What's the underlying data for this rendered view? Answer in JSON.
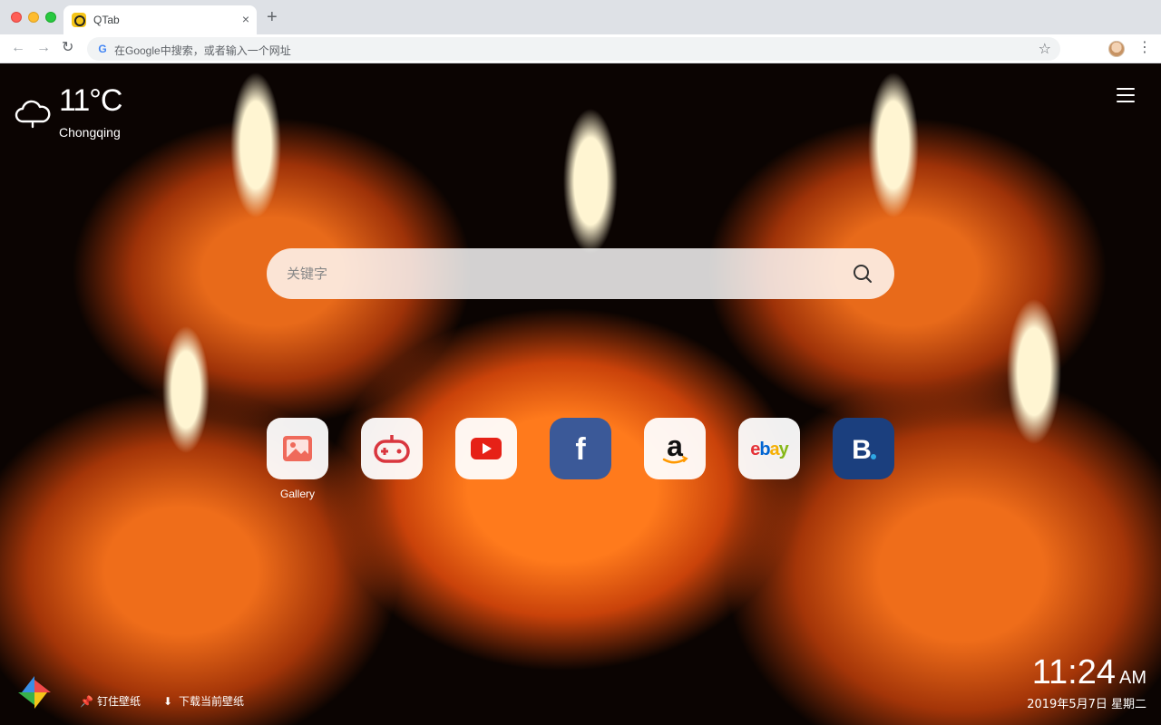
{
  "browser": {
    "tab_title": "QTab",
    "tab_close": "×",
    "new_tab": "+",
    "back": "←",
    "forward": "→",
    "reload": "↻",
    "omnibox_placeholder": "在Google中搜索，或者输入一个网址",
    "omnibox_icon": "G",
    "star": "☆",
    "menu": "⋮"
  },
  "weather": {
    "temperature": "11°C",
    "city": "Chongqing",
    "icon": "cloud-rain-icon"
  },
  "search": {
    "placeholder": "关键字"
  },
  "shortcuts": [
    {
      "name": "gallery",
      "label": "Gallery",
      "icon": "gallery-icon"
    },
    {
      "name": "games",
      "label": "",
      "icon": "gamepad-icon"
    },
    {
      "name": "youtube",
      "label": "",
      "icon": "youtube-icon"
    },
    {
      "name": "facebook",
      "label": "",
      "icon": "facebook-icon"
    },
    {
      "name": "amazon",
      "label": "",
      "icon": "amazon-icon"
    },
    {
      "name": "ebay",
      "label": "",
      "icon": "ebay-icon"
    },
    {
      "name": "booking",
      "label": "",
      "icon": "booking-icon"
    }
  ],
  "shortcut_text": {
    "facebook": "f",
    "amazon": "a",
    "ebay": [
      "e",
      "b",
      "a",
      "y"
    ],
    "booking": "B"
  },
  "bottom": {
    "pin_wallpaper": "钉住壁纸",
    "download_wallpaper": "下载当前壁纸"
  },
  "clock": {
    "time": "11:24",
    "ampm": "AM",
    "date": "2019年5月7日  星期二"
  },
  "colors": {
    "youtube_red": "#e62117",
    "facebook_blue": "#3b5998",
    "booking_blue": "#1b3f7e",
    "gallery_red": "#ef6a5b",
    "game_red": "#d9363e",
    "ebay": [
      "#e53238",
      "#0064d2",
      "#f5af02",
      "#86b817"
    ]
  }
}
